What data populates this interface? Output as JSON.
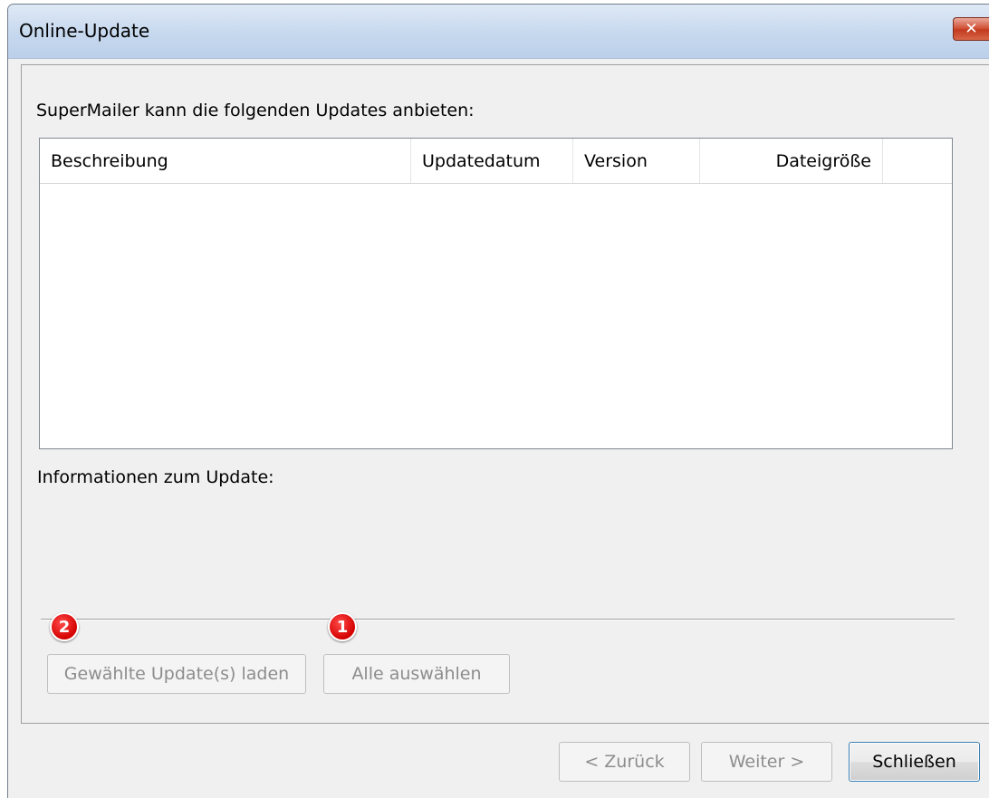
{
  "window": {
    "title": "Online-Update",
    "close_label": "✕"
  },
  "main": {
    "heading": "SuperMailer kann die folgenden Updates anbieten:",
    "columns": [
      "Beschreibung",
      "Updatedatum",
      "Version",
      "Dateigröße"
    ],
    "rows": [],
    "info_label": "Informationen zum Update:"
  },
  "actions": {
    "load_selected_label": "Gewählte Update(s) laden",
    "select_all_label": "Alle auswählen"
  },
  "badges": {
    "badge_1": "1",
    "badge_2": "2"
  },
  "footer": {
    "back_label": "< Zurück",
    "next_label": "Weiter >",
    "close_label": "Schließen"
  },
  "colors": {
    "badge_red": "#d40000",
    "titlebar": "#c6d8ee"
  }
}
